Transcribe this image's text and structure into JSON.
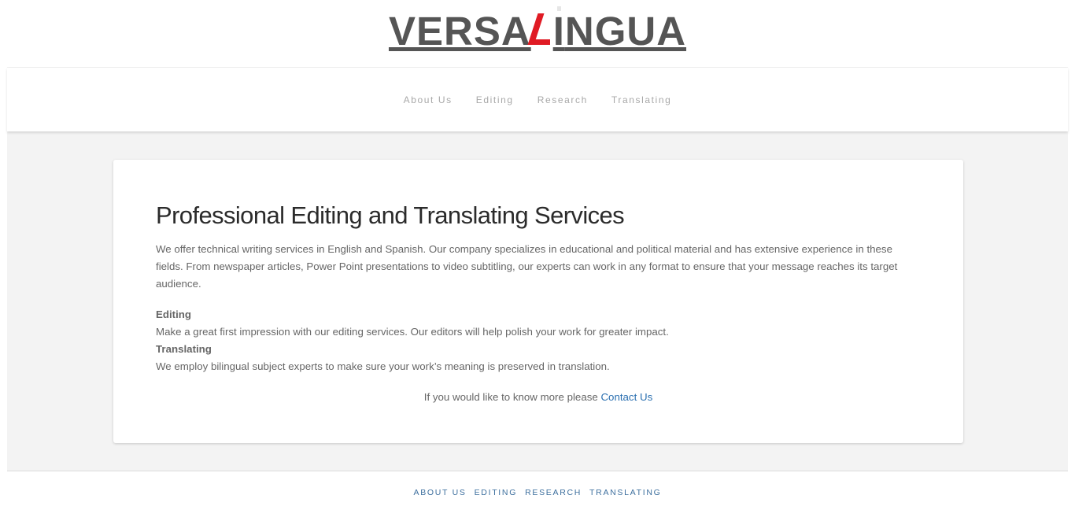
{
  "brand": {
    "logo_prefix": "VERSA",
    "logo_i": "I",
    "logo_suffix": "NGUA",
    "accent_color": "#e01b24",
    "text_color": "#555555"
  },
  "top_nav": {
    "items": [
      {
        "label": "About Us"
      },
      {
        "label": "Editing"
      },
      {
        "label": "Research"
      },
      {
        "label": "Translating"
      }
    ]
  },
  "content": {
    "title": "Professional Editing and Translating Services",
    "intro": "We offer technical writing services in English and Spanish. Our company specializes in educational and political material and has extensive experience in these fields. From newspaper articles, Power Point presentations to video subtitling, our experts can work in any format to ensure that your message reaches its target audience.",
    "services": [
      {
        "heading": "Editing",
        "text": "Make a great first impression with our editing services. Our editors will help polish your work for greater impact."
      },
      {
        "heading": "Translating",
        "text": "We employ bilingual subject experts to make sure your work’s meaning is preserved in translation."
      }
    ],
    "cta_text": "If you would like to know more please ",
    "cta_link": "Contact Us",
    "link_color": "#2a6fb0"
  },
  "footer_nav": {
    "items": [
      {
        "label": "About Us"
      },
      {
        "label": "Editing"
      },
      {
        "label": "Research"
      },
      {
        "label": "Translating"
      }
    ]
  }
}
